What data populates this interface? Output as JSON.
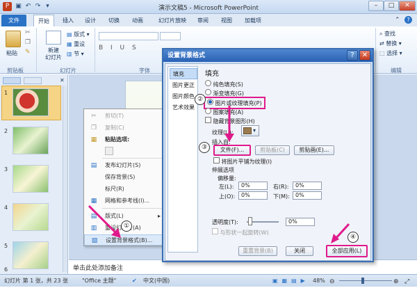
{
  "app": {
    "title": "演示文稿5 - Microsoft PowerPoint"
  },
  "tabs": [
    "文件",
    "开始",
    "插入",
    "设计",
    "切换",
    "动画",
    "幻灯片放映",
    "审阅",
    "视图",
    "加载项"
  ],
  "ribbon": {
    "paste": "粘贴",
    "new_slide": "新建\n幻灯片",
    "layout": "版式",
    "reset": "重设",
    "section": "节",
    "groups": {
      "clipboard": "剪贴板",
      "slides": "幻灯片",
      "font": "字体",
      "editing": "编辑"
    },
    "find": "查找",
    "replace": "替换",
    "select": "选择"
  },
  "thumbnails": [
    "1",
    "2",
    "3",
    "4",
    "5",
    "6"
  ],
  "context_menu": {
    "items": [
      "剪切(T)",
      "复制(C)",
      "粘贴选项:",
      "发布幻灯片(S)",
      "保存背景(S)",
      "标尺(R)",
      "网格和参考线(I)...",
      "版式(L)",
      "重设幻灯片(A)",
      "设置背景格式(B)..."
    ]
  },
  "dialog": {
    "title": "设置背景格式",
    "nav": [
      "填充",
      "图片更正",
      "图片颜色",
      "艺术效果"
    ],
    "section_fill": "填充",
    "options": [
      "纯色填充(S)",
      "渐变填充(G)",
      "图片或纹理填充(P)",
      "图案填充(A)"
    ],
    "hide_bg": "隐藏背景图形(H)",
    "texture_label": "纹理(U):",
    "insert_from": "插入自:",
    "btn_file": "文件(F)...",
    "btn_clipboard": "剪贴板(C)",
    "btn_clipart": "剪贴画(E)...",
    "tile": "将图片平铺为纹理(I)",
    "stretch": "伸展选项",
    "offset": "偏移量:",
    "left_label": "左(L):",
    "right_label": "右(R):",
    "top_label": "上(O):",
    "bottom_label": "下(M):",
    "offset_values": [
      "0%",
      "0%",
      "0%",
      "0%"
    ],
    "transparency_label": "透明度(T):",
    "transparency_value": "0%",
    "rotate_with_shape": "与形状一起旋转(W)",
    "btn_reset_bg": "重置背景(B)",
    "btn_close": "关闭",
    "btn_apply_all": "全部应用(L)"
  },
  "annotations": [
    "①",
    "②",
    "③",
    "④"
  ],
  "notes_placeholder": "单击此处添加备注",
  "status": {
    "slide_info": "幻灯片 第 1 张，共 23 张",
    "theme": "\"Office 主题\"",
    "language": "中文(中国)",
    "zoom": "48%"
  }
}
